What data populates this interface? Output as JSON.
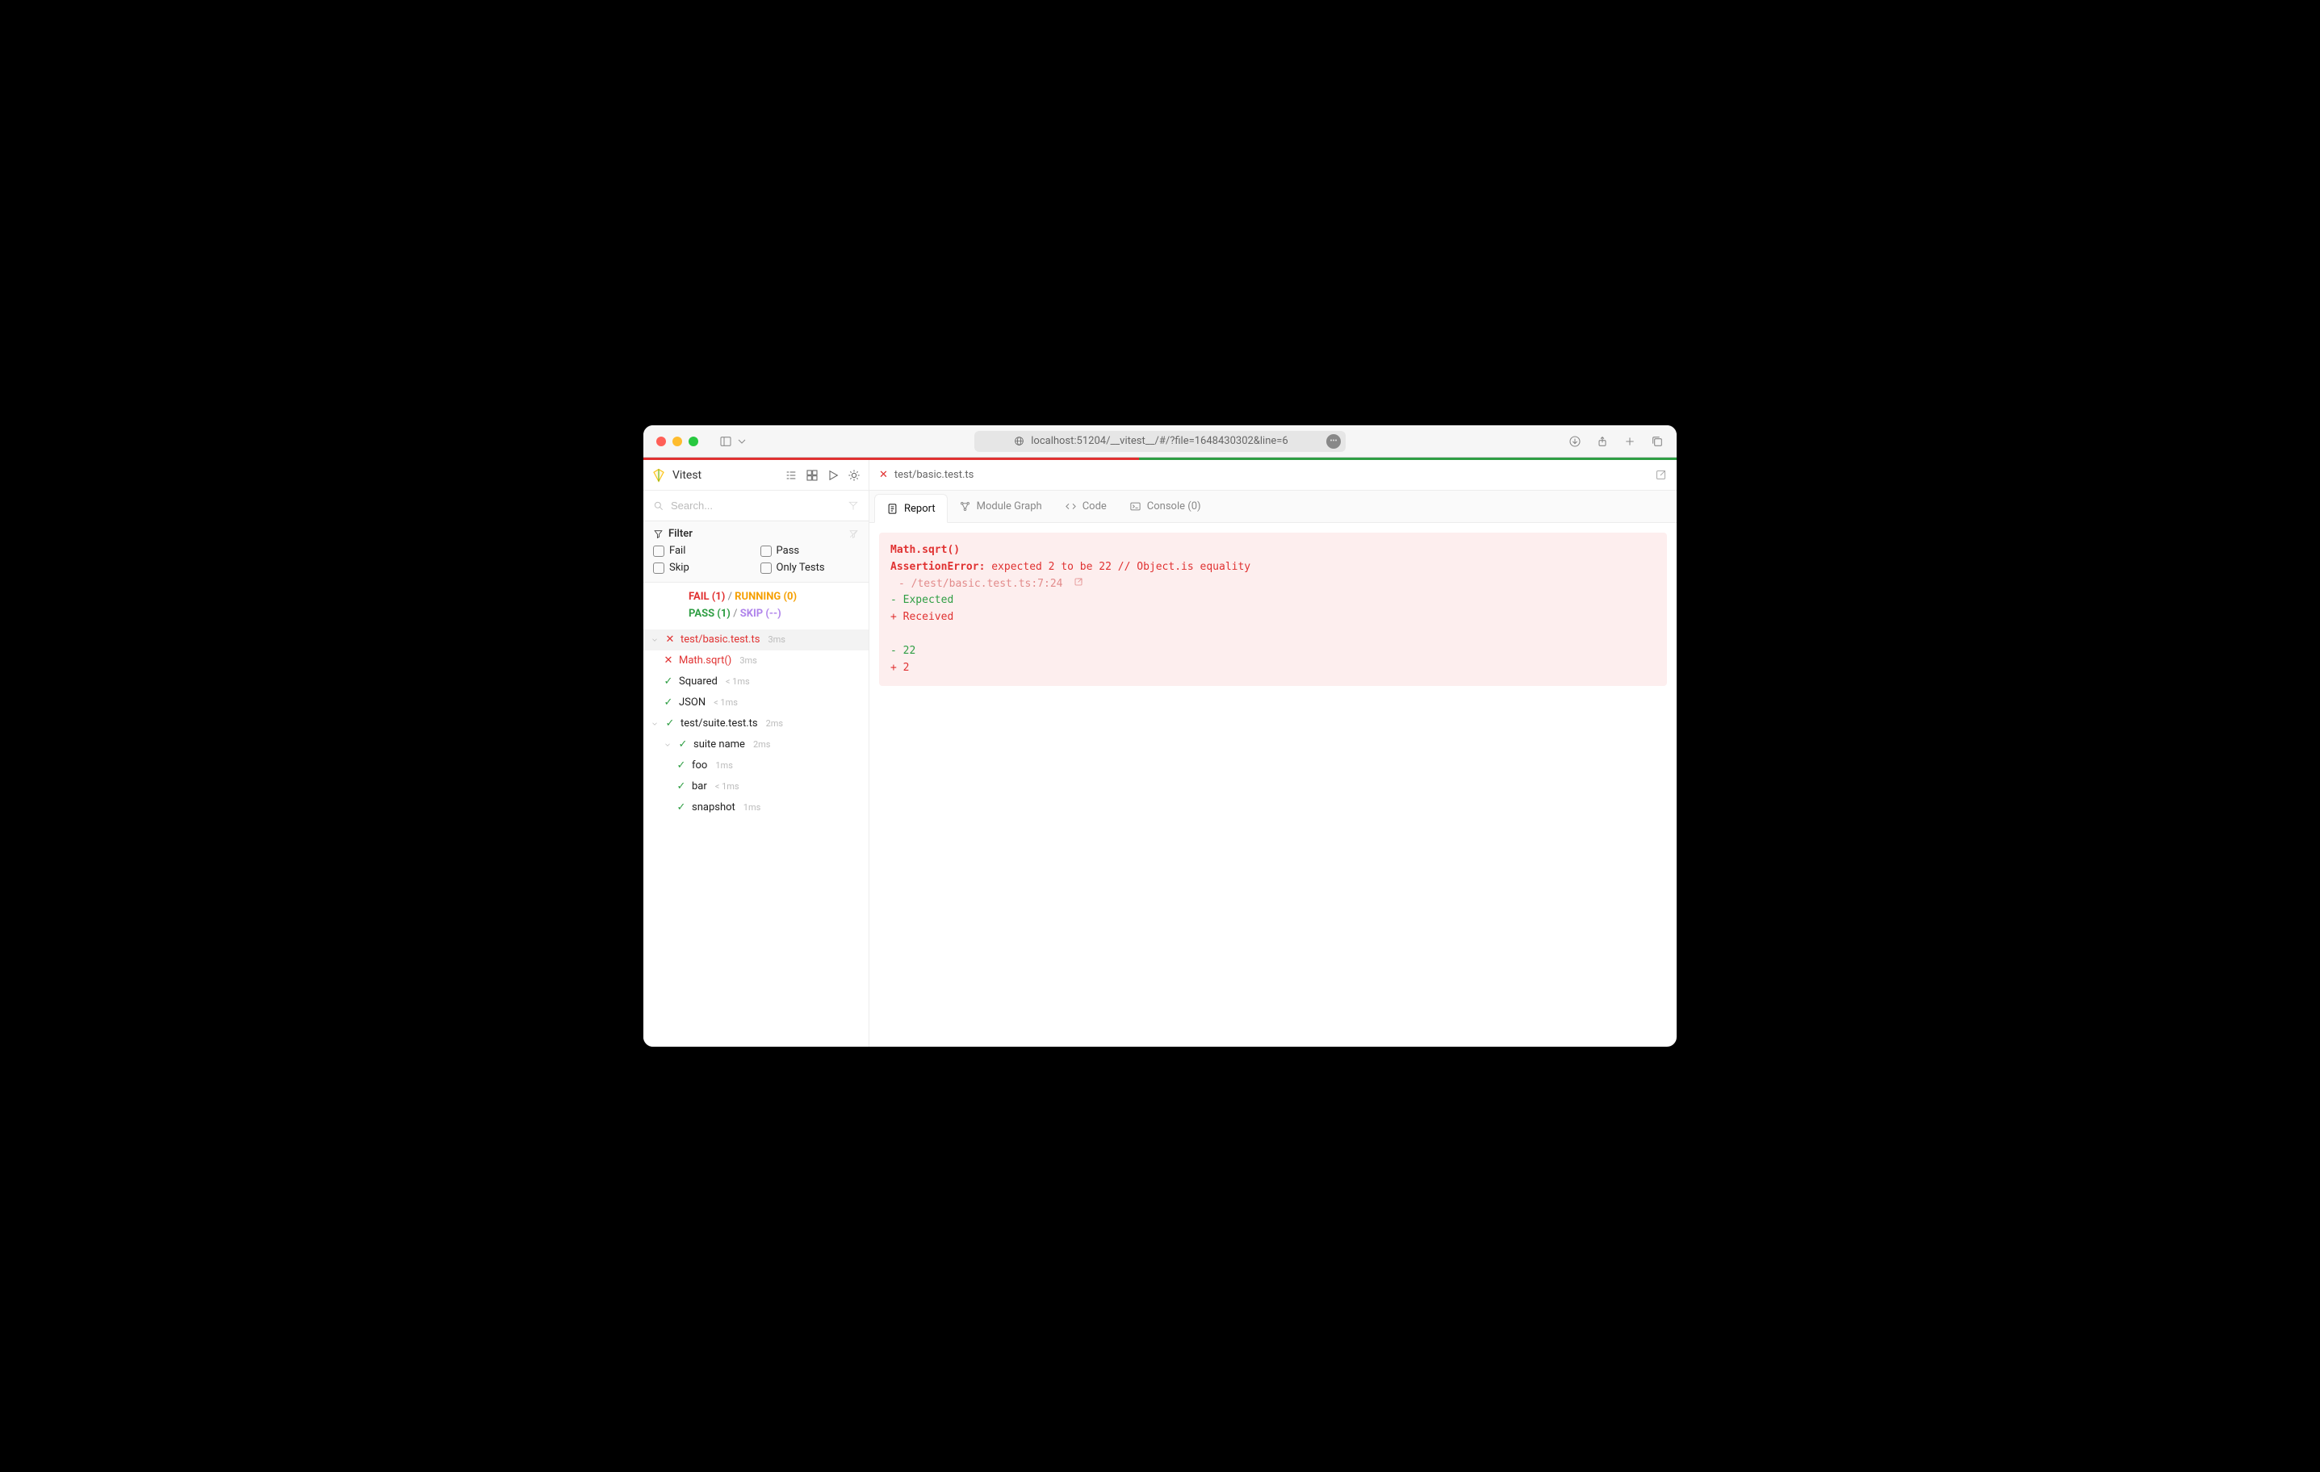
{
  "browser": {
    "url": "localhost:51204/__vitest__/#/?file=1648430302&line=6"
  },
  "sidebar": {
    "title": "Vitest",
    "search_placeholder": "Search...",
    "filter_label": "Filter",
    "filters": {
      "fail": "Fail",
      "pass": "Pass",
      "skip": "Skip",
      "only": "Only Tests"
    },
    "summary": {
      "fail": "FAIL (1)",
      "running": "RUNNING (0)",
      "pass": "PASS (1)",
      "skip": "SKIP (--)"
    },
    "tree": {
      "file1": {
        "name": "test/basic.test.ts",
        "dur": "3ms"
      },
      "t1": {
        "name": "Math.sqrt()",
        "dur": "3ms"
      },
      "t2": {
        "name": "Squared",
        "dur": "< 1ms"
      },
      "t3": {
        "name": "JSON",
        "dur": "< 1ms"
      },
      "file2": {
        "name": "test/suite.test.ts",
        "dur": "2ms"
      },
      "suite": {
        "name": "suite name",
        "dur": "2ms"
      },
      "s1": {
        "name": "foo",
        "dur": "1ms"
      },
      "s2": {
        "name": "bar",
        "dur": "< 1ms"
      },
      "s3": {
        "name": "snapshot",
        "dur": "1ms"
      }
    }
  },
  "main": {
    "file_tab": "test/basic.test.ts",
    "tabs": {
      "report": "Report",
      "module": "Module Graph",
      "code": "Code",
      "console": "Console (0)"
    },
    "error": {
      "title": "Math.sqrt()",
      "kw": "AssertionError:",
      "msg": "expected 2 to be 22 // Object.is equality",
      "loc": "- /test/basic.test.ts:7:24",
      "exp_label": "- Expected",
      "rec_label": "+ Received",
      "exp_val": "- 22",
      "rec_val": "+ 2"
    }
  }
}
